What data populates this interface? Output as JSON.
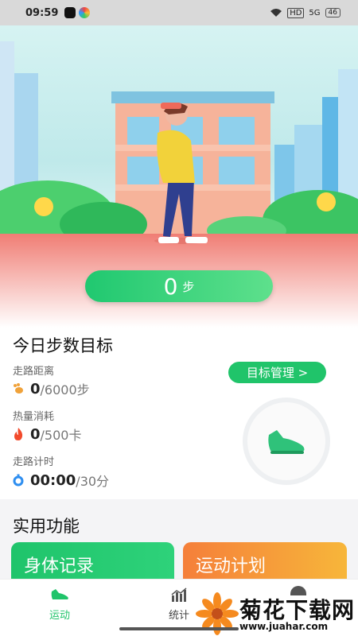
{
  "status_bar": {
    "time": "09:59",
    "network": "HD",
    "signal": "5G",
    "battery": "46"
  },
  "hero": {
    "steps_value": "0",
    "steps_unit": "步"
  },
  "goal": {
    "title": "今日步数目标",
    "manage_label": "目标管理 >",
    "metrics": [
      {
        "label": "走路距离",
        "current": "0",
        "target": "/6000步"
      },
      {
        "label": "热量消耗",
        "current": "0",
        "target": "/500卡"
      },
      {
        "label": "走路计时",
        "current": "00:00",
        "target": "/30分"
      }
    ]
  },
  "features": {
    "title": "实用功能",
    "items": [
      {
        "label": "身体记录"
      },
      {
        "label": "运动计划"
      }
    ]
  },
  "nav": {
    "items": [
      {
        "label": "运动",
        "icon": "shoe-icon",
        "active": true
      },
      {
        "label": "统计",
        "icon": "bar-chart-icon",
        "active": false
      }
    ]
  },
  "watermark": {
    "title": "菊花下载网",
    "url": "www.juahar.com"
  },
  "colors": {
    "accent": "#20c46a",
    "plan_orange": "#f5a02a"
  }
}
